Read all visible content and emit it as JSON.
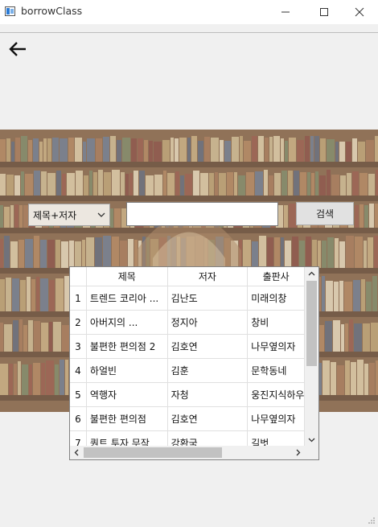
{
  "window": {
    "title": "borrowClass"
  },
  "search": {
    "mode": "제목+저자",
    "value": "",
    "button_label": "검색"
  },
  "table": {
    "headers": [
      "제목",
      "저자",
      "출판사"
    ],
    "rows": [
      {
        "num": "1",
        "title": "트렌드 코리아 ...",
        "author": "김난도",
        "publisher": "미래의창"
      },
      {
        "num": "2",
        "title": "아버지의 ...",
        "author": "정지아",
        "publisher": "창비"
      },
      {
        "num": "3",
        "title": "불편한 편의점 2",
        "author": "김호연",
        "publisher": "나무옆의자"
      },
      {
        "num": "4",
        "title": "하얼빈",
        "author": "김훈",
        "publisher": "문학동네"
      },
      {
        "num": "5",
        "title": "역행자",
        "author": "자청",
        "publisher": "웅진지식하우스"
      },
      {
        "num": "6",
        "title": "불편한 편의점",
        "author": "김호연",
        "publisher": "나무옆의자"
      },
      {
        "num": "7",
        "title": "퀀트 투자 무작",
        "author": "강환국",
        "publisher": "길벗"
      }
    ]
  },
  "colors": {
    "wood": "#7b5a3f",
    "shelf": "#8b6a4d",
    "window_bg": "#f0f0f0"
  }
}
